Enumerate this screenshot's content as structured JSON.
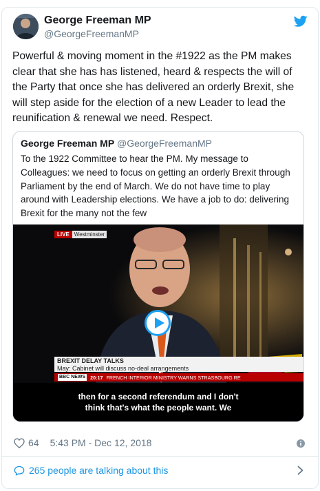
{
  "tweet": {
    "author_name": "George Freeman MP",
    "author_handle": "@GeorgeFreemanMP",
    "text": "Powerful & moving moment in the #1922 as the PM makes clear that she has has listened, heard & respects the will of the Party that once she has delivered an orderly Brexit, she will step aside for the election of a new Leader to lead the reunification & renewal we need. Respect.",
    "likes": "64",
    "timestamp": "5:43 PM - Dec 12, 2018",
    "talking_text": "265 people are talking about this"
  },
  "quoted_tweet": {
    "author_name": "George Freeman MP",
    "author_handle": "@GeorgeFreemanMP",
    "text": "To the 1922 Committee to hear the PM. My message to Colleagues: we need to focus on getting an orderly Brexit through Parliament by the end of March.  We do not have time to play around with Leadership elections. We have a job to do: delivering Brexit for the many not the few"
  },
  "video": {
    "live_label": "LIVE",
    "location": "Westminster",
    "headline": "BREXIT DELAY TALKS",
    "subheadline": "May: Cabinet will discuss no-deal arrangements",
    "ticker_channel": "BBC NEWS",
    "ticker_time": "20:17",
    "ticker_text": "FRENCH INTERIOR MINISTRY WARNS STRASBOURG RE",
    "subtitle_line1": "then for a second referendum and I don't",
    "subtitle_line2": "think that's what the people want. We"
  },
  "icons": {
    "brand": "twitter-bird-icon",
    "like": "heart-icon",
    "info": "info-icon",
    "comments": "speech-bubble-icon",
    "more": "chevron-right-icon",
    "play": "play-icon"
  },
  "colors": {
    "twitter_blue": "#1da1f2",
    "link_blue": "#1b95e0",
    "muted_text": "#657786",
    "bbc_red": "#b80000"
  }
}
